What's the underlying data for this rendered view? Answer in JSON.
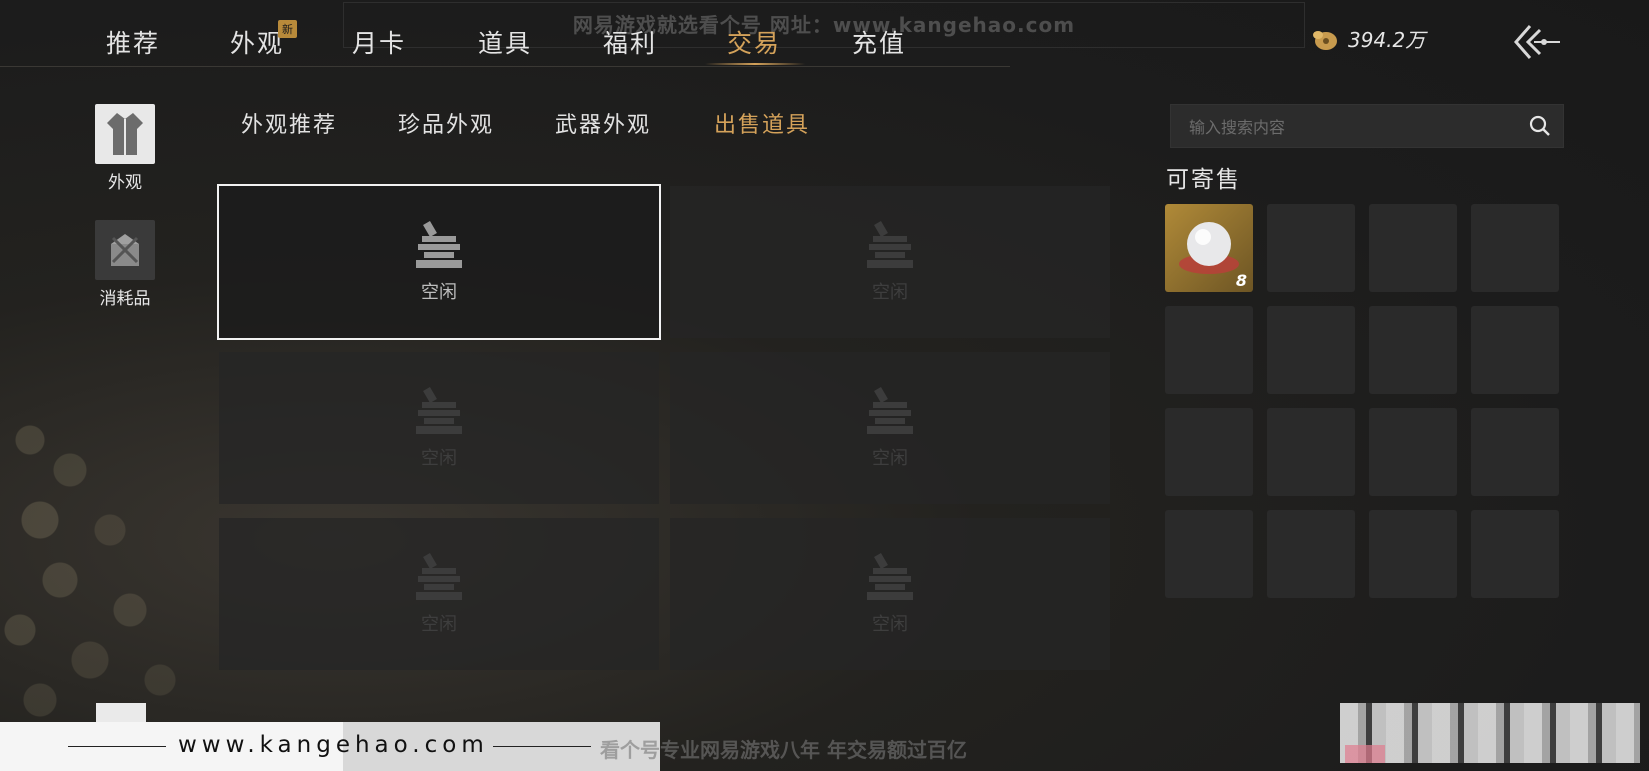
{
  "watermark_top": "网易游戏就选看个号 网址：www.kangehao.com",
  "nav": {
    "tabs": [
      "推荐",
      "外观",
      "月卡",
      "道具",
      "福利",
      "交易",
      "充值"
    ],
    "new_badge": "新",
    "active_tab": "交易"
  },
  "currency": {
    "value": "394.2万",
    "icon": "coin-pouch-icon"
  },
  "categories": [
    {
      "label": "外观",
      "icon": "robe-icon"
    },
    {
      "label": "消耗品",
      "icon": "package-icon"
    }
  ],
  "subtabs": [
    "外观推荐",
    "珍品外观",
    "武器外观",
    "出售道具"
  ],
  "active_subtab": "出售道具",
  "slots": {
    "label": "空闲",
    "items": [
      "空闲",
      "空闲",
      "空闲",
      "空闲",
      "空闲",
      "空闲"
    ]
  },
  "search": {
    "placeholder": "输入搜索内容"
  },
  "sellable": {
    "title": "可寄售",
    "items": [
      {
        "name": "pearl",
        "count": "8"
      }
    ]
  },
  "footer": {
    "url": "www.kangehao.com",
    "slogan": "看个号专业网易游戏八年  年交易额过百亿"
  },
  "colors": {
    "accent": "#d4a25a",
    "background": "#1c1c1c",
    "slot": "#262626"
  }
}
